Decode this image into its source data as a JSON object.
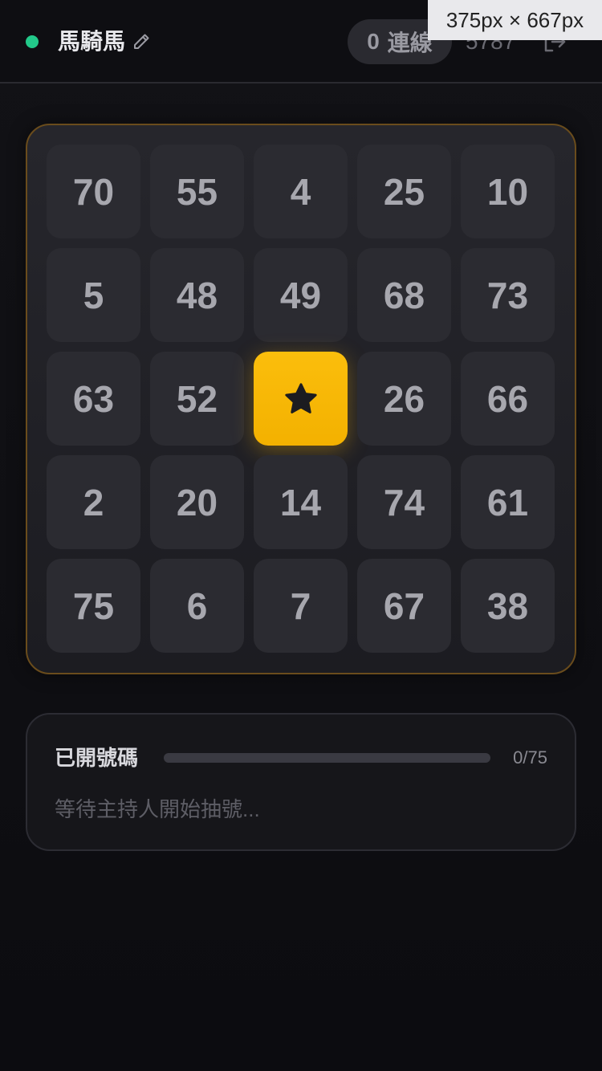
{
  "header": {
    "player_name": "馬騎馬",
    "lines_count": "0",
    "lines_label": "連線",
    "room_code": "5787",
    "size_tooltip": "375px × 667px",
    "status_color": "#22c98a"
  },
  "board": {
    "cells": [
      [
        "70",
        "55",
        "4",
        "25",
        "10"
      ],
      [
        "5",
        "48",
        "49",
        "68",
        "73"
      ],
      [
        "63",
        "52",
        "★",
        "26",
        "66"
      ],
      [
        "2",
        "20",
        "14",
        "74",
        "61"
      ],
      [
        "75",
        "6",
        "7",
        "67",
        "38"
      ]
    ],
    "free_cell_icon": "star-icon",
    "free_cell_color": "#f5b400"
  },
  "drawn": {
    "title": "已開號碼",
    "progress_text": "0/75",
    "progress_fraction": 0,
    "waiting_text": "等待主持人開始抽號..."
  }
}
